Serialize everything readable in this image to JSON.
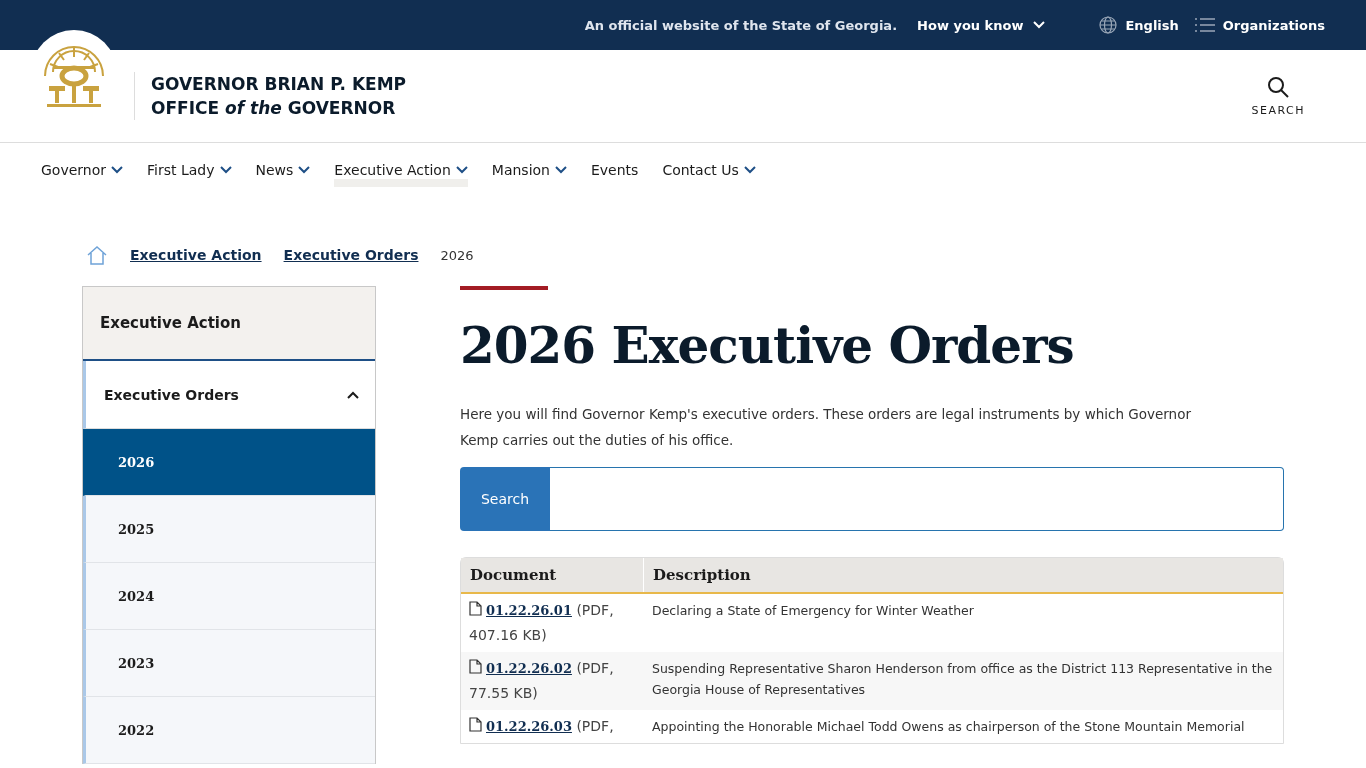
{
  "utility_bar": {
    "notice": "An official website of the State of Georgia.",
    "how_you_know": "How you know",
    "language": "English",
    "organizations": "Organizations"
  },
  "header": {
    "title_line1": "GOVERNOR BRIAN P. KEMP",
    "title_line2": "OFFICE *of the* GOVERNOR",
    "search_label": "SEARCH"
  },
  "nav": [
    {
      "label": "Governor",
      "has_menu": true,
      "selected": false
    },
    {
      "label": "First Lady",
      "has_menu": true,
      "selected": false
    },
    {
      "label": "News",
      "has_menu": true,
      "selected": false
    },
    {
      "label": "Executive Action",
      "has_menu": true,
      "selected": true
    },
    {
      "label": "Mansion",
      "has_menu": true,
      "selected": false
    },
    {
      "label": "Events",
      "has_menu": false,
      "selected": false
    },
    {
      "label": "Contact Us",
      "has_menu": true,
      "selected": false
    }
  ],
  "breadcrumb": [
    {
      "label": "Executive Action",
      "link": true
    },
    {
      "label": "Executive Orders",
      "link": true
    },
    {
      "label": "2026",
      "link": false
    }
  ],
  "sidebar": {
    "title": "Executive Action",
    "section": {
      "label": "Executive Orders",
      "expanded": true
    },
    "years": [
      {
        "label": "2026",
        "selected": true
      },
      {
        "label": "2025",
        "selected": false
      },
      {
        "label": "2024",
        "selected": false
      },
      {
        "label": "2023",
        "selected": false
      },
      {
        "label": "2022",
        "selected": false
      }
    ]
  },
  "page": {
    "heading": "2026 Executive Orders",
    "intro": "Here you will find Governor Kemp's executive orders. These orders are legal instruments by which Governor Kemp carries out the duties of his office.",
    "search_button": "Search"
  },
  "table": {
    "columns": [
      "Document",
      "Description"
    ],
    "rows": [
      {
        "document": "01.22.26.01",
        "file_info": "(PDF, 407.16 KB)",
        "description": "Declaring a State of Emergency for Winter Weather"
      },
      {
        "document": "01.22.26.02",
        "file_info": "(PDF, 77.55 KB)",
        "description": "Suspending Representative Sharon Henderson from office as the District 113 Representative in the Georgia House of Representatives"
      },
      {
        "document": "01.22.26.03",
        "file_info": "(PDF,",
        "description": "Appointing the Honorable Michael Todd Owens as chairperson of the Stone Mountain Memorial"
      }
    ]
  }
}
